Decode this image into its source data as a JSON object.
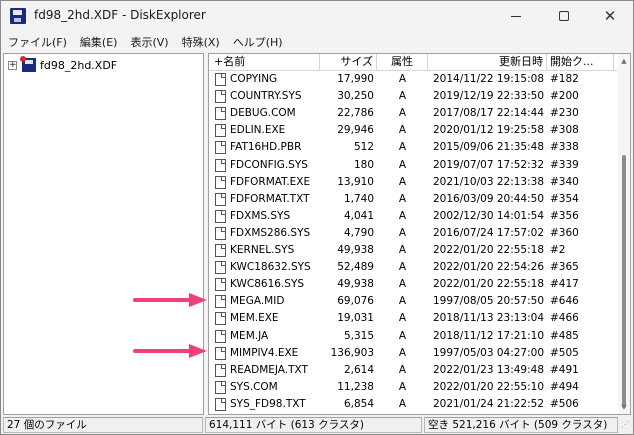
{
  "window": {
    "title": "fd98_2hd.XDF - DiskExplorer",
    "min_glyph": "—",
    "close_glyph": "✕"
  },
  "menu": [
    "ファイル(F)",
    "編集(E)",
    "表示(V)",
    "特殊(X)",
    "ヘルプ(H)"
  ],
  "tree": {
    "expander": "+",
    "root_label": "fd98_2hd.XDF"
  },
  "columns": {
    "name": "+名前",
    "size": "サイズ",
    "attr": "属性",
    "date": "更新日時",
    "cluster": "開始ク..."
  },
  "files": [
    {
      "name": "COPYING",
      "size": "17,990",
      "attr": "A",
      "date": "2014/11/22 19:15:08",
      "cluster": "#182"
    },
    {
      "name": "COUNTRY.SYS",
      "size": "30,250",
      "attr": "A",
      "date": "2019/12/19 22:33:50",
      "cluster": "#200"
    },
    {
      "name": "DEBUG.COM",
      "size": "22,786",
      "attr": "A",
      "date": "2017/08/17 22:14:44",
      "cluster": "#230"
    },
    {
      "name": "EDLIN.EXE",
      "size": "29,946",
      "attr": "A",
      "date": "2020/01/12 19:25:58",
      "cluster": "#308"
    },
    {
      "name": "FAT16HD.PBR",
      "size": "512",
      "attr": "A",
      "date": "2015/09/06 21:35:48",
      "cluster": "#338"
    },
    {
      "name": "FDCONFIG.SYS",
      "size": "180",
      "attr": "A",
      "date": "2019/07/07 17:52:32",
      "cluster": "#339"
    },
    {
      "name": "FDFORMAT.EXE",
      "size": "13,910",
      "attr": "A",
      "date": "2021/10/03 22:13:38",
      "cluster": "#340"
    },
    {
      "name": "FDFORMAT.TXT",
      "size": "1,740",
      "attr": "A",
      "date": "2016/03/09 20:44:50",
      "cluster": "#354"
    },
    {
      "name": "FDXMS.SYS",
      "size": "4,041",
      "attr": "A",
      "date": "2002/12/30 14:01:54",
      "cluster": "#356"
    },
    {
      "name": "FDXMS286.SYS",
      "size": "4,790",
      "attr": "A",
      "date": "2016/07/24 17:57:02",
      "cluster": "#360"
    },
    {
      "name": "KERNEL.SYS",
      "size": "49,938",
      "attr": "A",
      "date": "2022/01/20 22:55:18",
      "cluster": "#2"
    },
    {
      "name": "KWC18632.SYS",
      "size": "52,489",
      "attr": "A",
      "date": "2022/01/20 22:54:26",
      "cluster": "#365"
    },
    {
      "name": "KWC8616.SYS",
      "size": "49,938",
      "attr": "A",
      "date": "2022/01/20 22:55:18",
      "cluster": "#417"
    },
    {
      "name": "MEGA.MID",
      "size": "69,076",
      "attr": "A",
      "date": "1997/08/05 20:57:50",
      "cluster": "#646"
    },
    {
      "name": "MEM.EXE",
      "size": "19,031",
      "attr": "A",
      "date": "2018/11/13 23:13:04",
      "cluster": "#466"
    },
    {
      "name": "MEM.JA",
      "size": "5,315",
      "attr": "A",
      "date": "2018/11/12 17:21:10",
      "cluster": "#485"
    },
    {
      "name": "MIMPIV4.EXE",
      "size": "136,903",
      "attr": "A",
      "date": "1997/05/03 04:27:00",
      "cluster": "#505"
    },
    {
      "name": "READMEJA.TXT",
      "size": "2,614",
      "attr": "A",
      "date": "2022/01/23 13:49:48",
      "cluster": "#491"
    },
    {
      "name": "SYS.COM",
      "size": "11,238",
      "attr": "A",
      "date": "2022/01/20 22:55:10",
      "cluster": "#494"
    },
    {
      "name": "SYS_FD98.TXT",
      "size": "6,854",
      "attr": "A",
      "date": "2021/01/24 21:22:52",
      "cluster": "#506"
    }
  ],
  "status": {
    "count": "27 個のファイル",
    "total": "614,111 バイト (613 クラスタ)",
    "free": "空き 521,216 バイト (509 クラスタ)"
  },
  "annotations": {
    "arrow_color": "#f0407a"
  }
}
